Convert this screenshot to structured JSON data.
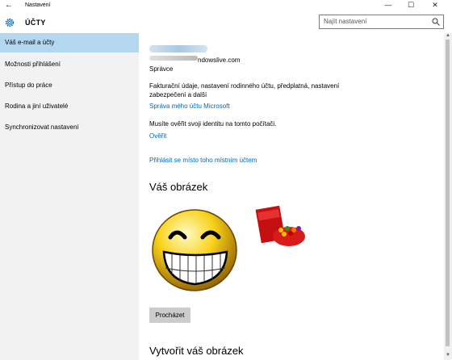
{
  "window": {
    "title": "Nastavení",
    "back_icon": "arrow-left-icon"
  },
  "header": {
    "app_title": "ÚČTY",
    "app_icon": "gear-icon"
  },
  "search": {
    "placeholder": "Najít nastavení"
  },
  "sidebar": {
    "items": [
      {
        "label": "Váš e-mail a účty",
        "active": true
      },
      {
        "label": "Možnosti přihlášení",
        "active": false
      },
      {
        "label": "Přístup do práce",
        "active": false
      },
      {
        "label": "Rodina a jiní uživatelé",
        "active": false
      },
      {
        "label": "Synchronizovat nastavení",
        "active": false
      }
    ]
  },
  "account": {
    "email_suffix": "ndowslive.com",
    "role": "Správce",
    "billing_text_line1": "Fakturační údaje, nastavení rodinného účtu, předplatná, nastavení",
    "billing_text_line2": "zabezpečení a další",
    "manage_link": "Správa mého účtu Microsoft",
    "verify_text": "Musíte ověřit svoji identitu na tomto počítači.",
    "verify_link": "Ověřit",
    "local_link": "Přihlásit se místo toho místním účtem"
  },
  "picture": {
    "heading": "Váš obrázek",
    "browse_button": "Procházet",
    "create_heading": "Vytvořit váš obrázek"
  },
  "colors": {
    "accent": "#0067b8",
    "sidebar_active": "#b4d7f0",
    "sidebar_bg": "#f2f2f2"
  }
}
